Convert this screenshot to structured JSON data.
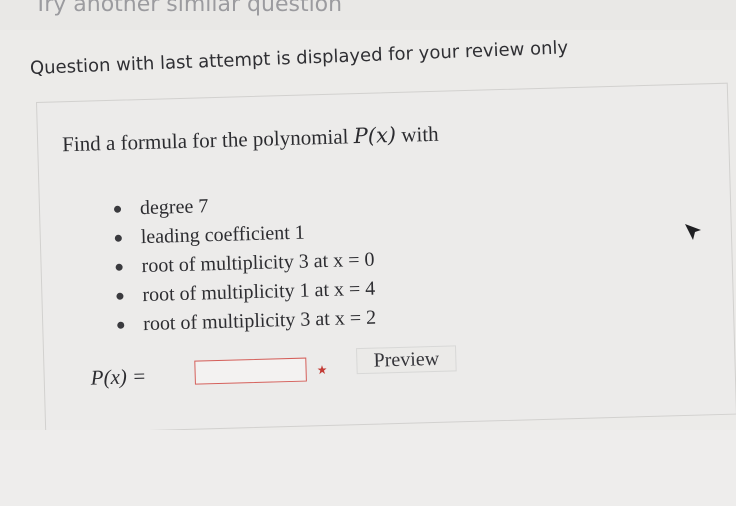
{
  "header": {
    "link_text": "Try another similar question"
  },
  "review_note": "Question with last attempt is displayed for your review only",
  "question": {
    "prompt_prefix": "Find a formula for the polynomial ",
    "prompt_function": "P(x)",
    "prompt_suffix": " with",
    "requirements": [
      "degree 7",
      "leading coefficient 1",
      "root of multiplicity 3 at x = 0",
      "root of multiplicity 1 at x = 4",
      "root of multiplicity 3 at x = 2"
    ],
    "answer_label": "P(x) =",
    "answer_value": "",
    "preview_label": "Preview"
  },
  "icons": {
    "cursor": "mouse-pointer-icon",
    "status": "answer-status-icon"
  },
  "colors": {
    "input_border": "#d45f5a",
    "status_icon": "#c33b35",
    "page_background": "#ecebe9"
  }
}
